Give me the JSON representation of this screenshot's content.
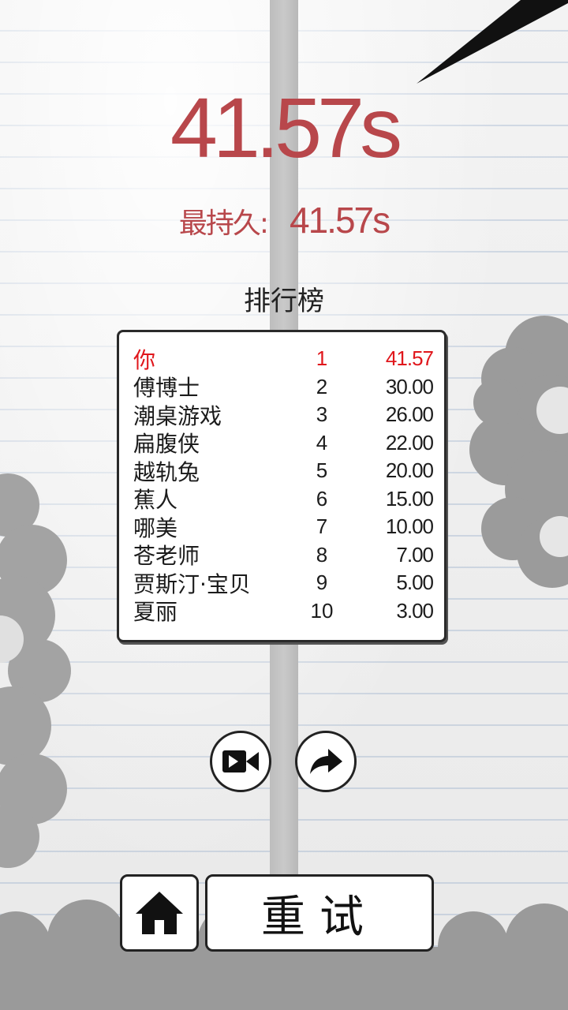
{
  "result": {
    "time": "41.57s",
    "best_label": "最持久:",
    "best_time": "41.57s"
  },
  "leaderboard": {
    "title": "排行榜",
    "rows": [
      {
        "name": "你",
        "rank": "1",
        "time": "41.57"
      },
      {
        "name": "傅博士",
        "rank": "2",
        "time": "30.00"
      },
      {
        "name": "潮桌游戏",
        "rank": "3",
        "time": "26.00"
      },
      {
        "name": "扁腹侠",
        "rank": "4",
        "time": "22.00"
      },
      {
        "name": "越轨兔",
        "rank": "5",
        "time": "20.00"
      },
      {
        "name": "蕉人",
        "rank": "6",
        "time": "15.00"
      },
      {
        "name": "哪美",
        "rank": "7",
        "time": "10.00"
      },
      {
        "name": "苍老师",
        "rank": "8",
        "time": "7.00"
      },
      {
        "name": "贾斯汀·宝贝",
        "rank": "9",
        "time": "5.00"
      },
      {
        "name": "夏丽",
        "rank": "10",
        "time": "3.00"
      }
    ]
  },
  "actions": {
    "video_icon": "video-record-icon",
    "share_icon": "share-arrow-icon",
    "home_icon": "home-icon",
    "retry_label": "重试"
  },
  "colors": {
    "score": "#b8474b",
    "player_highlight": "#e0171c"
  }
}
